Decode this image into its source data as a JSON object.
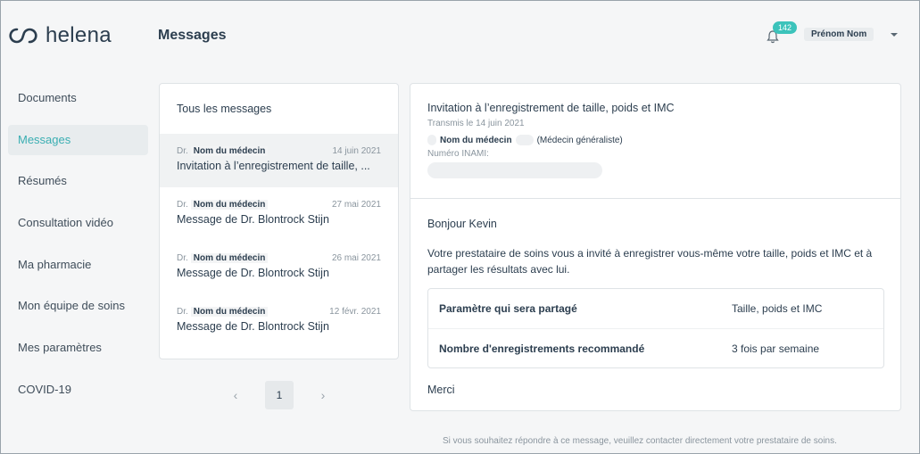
{
  "app": {
    "name": "helena"
  },
  "header": {
    "title": "Messages",
    "notification_count": "142",
    "user_name": "Prénom Nom"
  },
  "sidebar": {
    "items": [
      {
        "label": "Documents"
      },
      {
        "label": "Messages",
        "active": true
      },
      {
        "label": "Résumés"
      },
      {
        "label": "Consultation vidéo"
      },
      {
        "label": "Ma pharmacie"
      },
      {
        "label": "Mon équipe de soins"
      },
      {
        "label": "Mes paramètres"
      },
      {
        "label": "COVID-19"
      }
    ]
  },
  "message_list": {
    "heading": "Tous les messages",
    "items": [
      {
        "prefix": "Dr.",
        "doctor": "Nom du médecin",
        "date": "14 juin 2021",
        "title": "Invitation à l’enregistrement de taille, ..."
      },
      {
        "prefix": "Dr.",
        "doctor": "Nom du médecin",
        "date": "27 mai 2021",
        "title": "Message de Dr. Blontrock Stijn"
      },
      {
        "prefix": "Dr.",
        "doctor": "Nom du médecin",
        "date": "26 mai 2021",
        "title": "Message de Dr. Blontrock Stijn"
      },
      {
        "prefix": "Dr.",
        "doctor": "Nom du médecin",
        "date": "12 févr. 2021",
        "title": "Message de Dr. Blontrock Stijn"
      }
    ]
  },
  "pagination": {
    "current_page": "1",
    "prev": "‹",
    "next": "›"
  },
  "detail": {
    "title": "Invitation à l’enregistrement de taille, poids et IMC",
    "sent": "Transmis le 14 juin 2021",
    "doctor": "Nom du médecin",
    "role": "(Médecin généraliste)",
    "inami_label": "Numéro INAMI:",
    "greeting": "Bonjour Kevin",
    "body": "Votre prestataire de soins vous a invité à enregistrer vous-même votre taille, poids et IMC et à partager les résultats avec lui.",
    "table": [
      {
        "label": "Paramètre qui sera partagé",
        "value": "Taille, poids et IMC"
      },
      {
        "label": "Nombre d'enregistrements recommandé",
        "value": "3 fois par semaine"
      }
    ],
    "thanks": "Merci"
  },
  "footer_note": "Si vous souhaitez répondre à ce message, veuillez contacter directement votre prestataire de soins.",
  "colors": {
    "accent": "#3cc3bb",
    "active_text": "#3aaeb2",
    "text": "#2c3e4f"
  }
}
